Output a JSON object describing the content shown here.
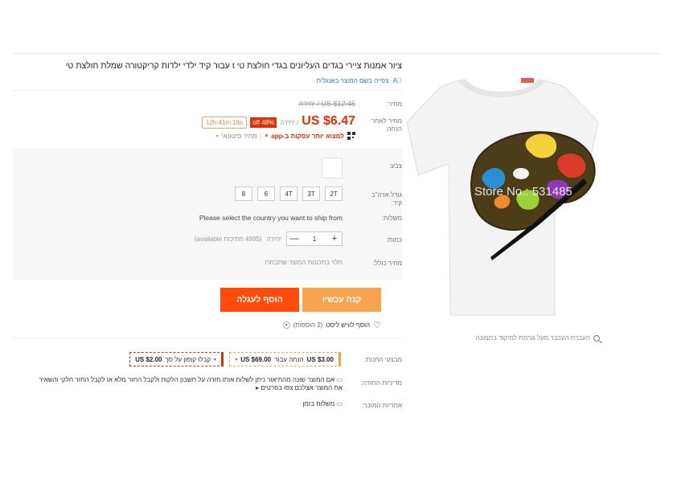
{
  "product": {
    "title": "ציור אמנות ציירי בגדים העליונים בגדי חולצת טי t עבור קיד ילדי ילדות קריקטורה שמלת חולצת טי",
    "translate_label": "צפייה בשם המוצר באנגלית",
    "translate_icon": "translate-icon"
  },
  "price": {
    "label": "מחיר:",
    "original": "US $12.45 / יחידה",
    "sale_label": "מחיר לאחר הנחה:",
    "sale_value": "US $6.47",
    "sale_unit": "/ יחידה",
    "discount": "48% off",
    "timer": "12h:41m:16s",
    "app_deal": "למצוא יותר עסקות ב-app",
    "app_arrow": "▾",
    "wholesale": "מחיר סיטונאי"
  },
  "options": {
    "color_label": "צבע:",
    "size_label": "גודל ארה\"ב קיד:",
    "sizes": [
      "2T",
      "3T",
      "4T",
      "6",
      "8"
    ],
    "ship_label": "משלוח:",
    "ship_text": "Please select the country you want to ship from",
    "qty_label": "כמות:",
    "qty_value": "1",
    "qty_minus": "—",
    "qty_plus": "+",
    "qty_unit": "יחידה",
    "qty_available": "(4995 חתיכות available)",
    "total_label": "מחיר כולל:",
    "total_text": "תלוי בתכונות המוצר שתבחרו"
  },
  "actions": {
    "buy_now": "קנה עכשיו",
    "add_to_cart": "הוסף לעגלה",
    "wishlist": "הוסף לוויש ליסט",
    "wishlist_count": "(2 הוספות)"
  },
  "promotions": {
    "label": "מבצעי החנות:",
    "coupon_a_value": "US $3.00",
    "coupon_a_text": "הנחה עבור",
    "coupon_a_threshold": "US $69.00",
    "coupon_b_text": "קבלו קופון על סך",
    "coupon_b_value": "US $2.00",
    "return_label": "מדיניות החזרה:",
    "return_text": "אם המוצר שונה מהתיאור ניתן לשלוח אותו חזרה על חשבון הלקוח ולקבל החזר מלא או לקבל החזר חלקי והשאיר את המוצר אצלכם צפו בפרטים ▸",
    "guarantee_label": "אחריות המוכר:",
    "guarantee_text": "משלוח בזמן"
  },
  "image": {
    "watermark": "Store No.: 531485",
    "hint": "העברת העכבר מעל גורמת למיקוד בתמונה"
  },
  "colors": {
    "accent": "#e62e04",
    "buy_button": "#f7a34f",
    "cart_button": "#ff4c0a"
  }
}
